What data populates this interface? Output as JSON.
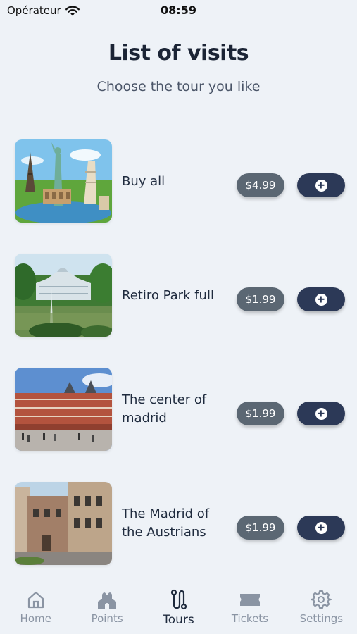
{
  "status_bar": {
    "carrier": "Opérateur",
    "time": "08:59"
  },
  "header": {
    "title": "List of visits",
    "subtitle": "Choose the tour you like"
  },
  "tours": [
    {
      "name": "Buy all",
      "price": "$4.99",
      "image": "world-landmarks"
    },
    {
      "name": "Retiro Park full",
      "price": "$1.99",
      "image": "crystal-palace"
    },
    {
      "name": "The center of madrid",
      "price": "$1.99",
      "image": "plaza-mayor"
    },
    {
      "name": "The Madrid of the Austrians",
      "price": "$1.99",
      "image": "austrian-madrid"
    }
  ],
  "tab_bar": {
    "items": [
      {
        "label": "Home",
        "icon": "house-icon"
      },
      {
        "label": "Points",
        "icon": "church-icon"
      },
      {
        "label": "Tours",
        "icon": "route-icon",
        "active": true
      },
      {
        "label": "Tickets",
        "icon": "ticket-icon"
      },
      {
        "label": "Settings",
        "icon": "gear-icon"
      }
    ]
  },
  "colors": {
    "background": "#eef2f7",
    "price_pill": "#5b6773",
    "add_button": "#2c3957",
    "inactive_tab": "#8a94a3"
  }
}
